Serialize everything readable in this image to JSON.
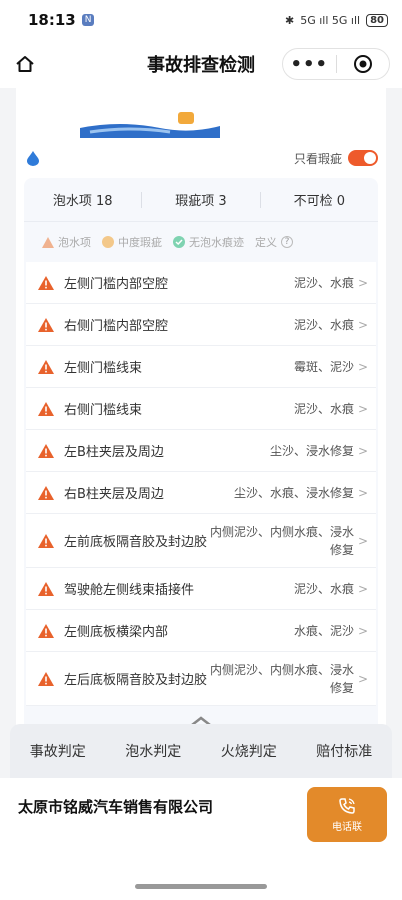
{
  "status_bar": {
    "time": "18:13",
    "badge": "N",
    "signal": "5G ıll 5G ıll",
    "battery": "80"
  },
  "nav": {
    "title": "事故排查检测",
    "more": "•••"
  },
  "toggle": {
    "label": "只看瑕疵",
    "on": true
  },
  "summary": [
    {
      "label": "泡水项 18"
    },
    {
      "label": "瑕疵项 3"
    },
    {
      "label": "不可检 0"
    }
  ],
  "legend": {
    "item1": "泡水项",
    "item2": "中度瑕疵",
    "item3": "无泡水痕迹",
    "item4": "定义"
  },
  "rows": [
    {
      "name": "左侧门槛内部空腔",
      "value": "泥沙、水痕"
    },
    {
      "name": "右侧门槛内部空腔",
      "value": "泥沙、水痕"
    },
    {
      "name": "左侧门槛线束",
      "value": "霉斑、泥沙"
    },
    {
      "name": "右侧门槛线束",
      "value": "泥沙、水痕"
    },
    {
      "name": "左B柱夹层及周边",
      "value": "尘沙、浸水修复"
    },
    {
      "name": "右B柱夹层及周边",
      "value": "尘沙、水痕、浸水修复"
    },
    {
      "name": "左前底板隔音胶及封边胶",
      "value": "内侧泥沙、内侧水痕、浸水修复"
    },
    {
      "name": "驾驶舱左侧线束插接件",
      "value": "泥沙、水痕"
    },
    {
      "name": "左侧底板横梁内部",
      "value": "水痕、泥沙"
    },
    {
      "name": "左后底板隔音胶及封边胶",
      "value": "内侧泥沙、内侧水痕、浸水修复"
    }
  ],
  "tabs": [
    "事故判定",
    "泡水判定",
    "火烧判定",
    "赔付标准"
  ],
  "footer": {
    "company": "太原市铭威汽车销售有限公司",
    "call_label": "电话联"
  },
  "colors": {
    "accent": "#ee5a2b",
    "call": "#e38a2a",
    "warn": "#e8622c"
  }
}
